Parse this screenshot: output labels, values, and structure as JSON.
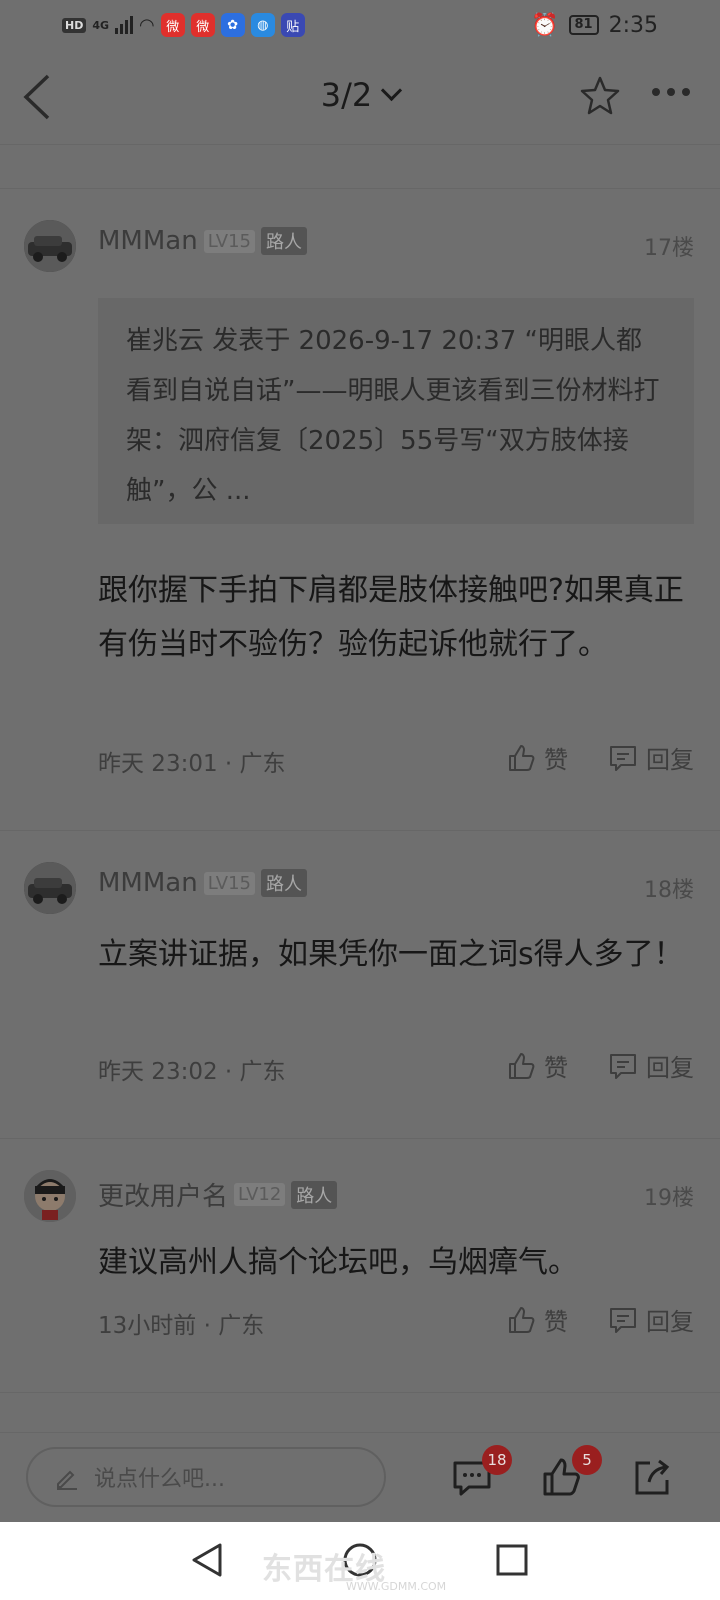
{
  "status_bar": {
    "time": "2:35",
    "battery": "81",
    "network_label": "HD",
    "network_type": "4G",
    "app_icons": [
      "weibo-icon",
      "weibo-icon",
      "baidu-icon",
      "browser-icon",
      "tieba-icon"
    ]
  },
  "header": {
    "page_indicator": "3/2"
  },
  "posts": [
    {
      "username": "MMMan",
      "level": "LV15",
      "role": "路人",
      "floor": "17楼",
      "quote": "崔兆云 发表于 2026-9-17 20:37 “明眼人都看到自说自话”——明眼人更该看到三份材料打架：泗府信复〔2025〕55号写“双方肢体接触”，公 ...",
      "content": "跟你握下手拍下肩都是肢体接触吧?如果真正有伤当时不验伤？验伤起诉他就行了。",
      "time_location": "昨天 23:01 · 广东",
      "like_label": "赞",
      "reply_label": "回复"
    },
    {
      "username": "MMMan",
      "level": "LV15",
      "role": "路人",
      "floor": "18楼",
      "content": "立案讲证据，如果凭你一面之词s得人多了！",
      "time_location": "昨天 23:02 · 广东",
      "like_label": "赞",
      "reply_label": "回复"
    },
    {
      "username": "更改用户名",
      "level": "LV12",
      "role": "路人",
      "floor": "19楼",
      "content": "建议高州人搞个论坛吧，乌烟瘴气。",
      "time_location": "13小时前 · 广东",
      "like_label": "赞",
      "reply_label": "回复"
    }
  ],
  "bottom_bar": {
    "input_placeholder": "说点什么吧...",
    "comment_count": "18",
    "like_count": "5"
  },
  "watermark": {
    "text": "东西在线",
    "sub": "WWW.GDMM.COM"
  },
  "colors": {
    "overlay_bg": "#6f6f6f",
    "badge_red": "#9a1f1f",
    "nav_bg": "#ffffff"
  }
}
